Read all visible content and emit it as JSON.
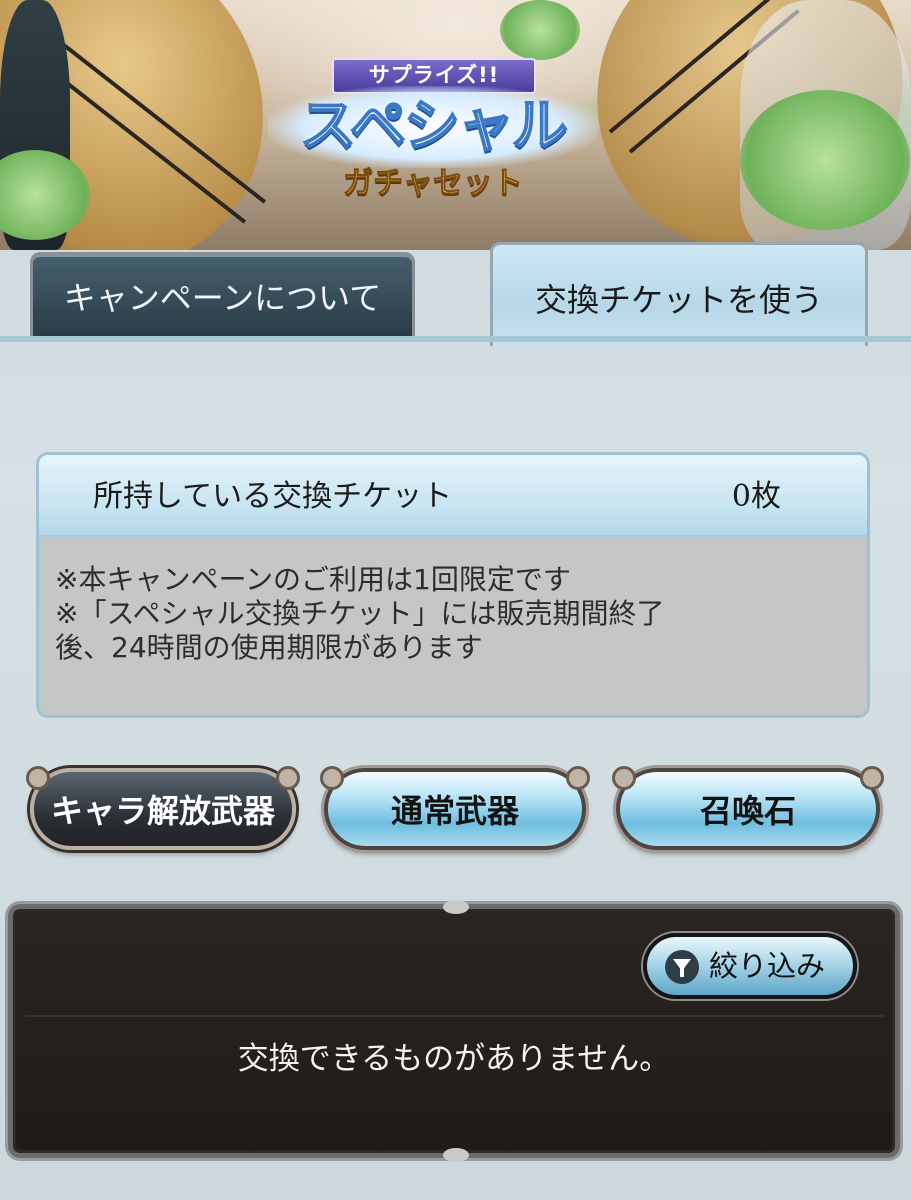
{
  "banner": {
    "logo_top": "サプライズ!!",
    "logo_main": "スペシャル",
    "logo_sub": "ガチャセット"
  },
  "tabs": [
    {
      "label": "キャンペーンについて",
      "active": false
    },
    {
      "label": "交換チケットを使う",
      "active": true
    }
  ],
  "ticket_panel": {
    "label": "所持している交換チケット",
    "count": "0枚",
    "notes": [
      "※本キャンペーンのご利用は1回限定です",
      "※「スペシャル交換チケット」には販売期間終了",
      "後、24時間の使用期限があります"
    ]
  },
  "categories": [
    {
      "label": "キャラ解放武器",
      "selected": true
    },
    {
      "label": "通常武器",
      "selected": false
    },
    {
      "label": "召喚石",
      "selected": false
    }
  ],
  "list": {
    "filter_label": "絞り込み",
    "empty_message": "交換できるものがありません。"
  },
  "colors": {
    "tab_active_bg": "#c6e1ec",
    "tab_inactive_bg": "#2a3c47",
    "panel_header_bg": "#c9e6f2",
    "panel_body_bg": "#c4c6c8",
    "list_bg": "#1f1b18"
  }
}
